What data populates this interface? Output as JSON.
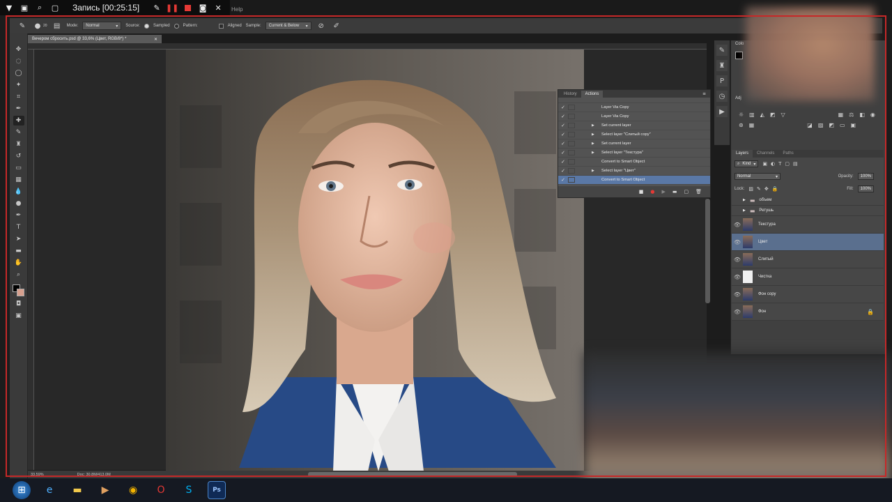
{
  "recorder": {
    "title": "Запись [00:25:15]",
    "icons": [
      "menu-icon",
      "window-icon",
      "zoom-icon",
      "crop-icon",
      "pen-icon",
      "pause-icon",
      "stop-icon",
      "camera-icon",
      "close-icon"
    ]
  },
  "menubar": {
    "help": "Help"
  },
  "options": {
    "mode_label": "Mode:",
    "mode_value": "Normal",
    "source_label": "Source:",
    "sampled_label": "Sampled",
    "pattern_label": "Pattern:",
    "aligned_label": "Aligned",
    "sample_label": "Sample:",
    "sample_value": "Current & Below",
    "brush_size": "20"
  },
  "document": {
    "tab_title": "Вечером сбросить.psd @ 33,6% (Цвет, RGB/8*) *",
    "zoom": "33,59%",
    "doc_info": "Doc: 30,8M/413,0M"
  },
  "actions_panel": {
    "tabs": [
      "History",
      "Actions"
    ],
    "active_tab": "Actions",
    "rows": [
      {
        "label": "Layer Via Copy",
        "arrow": false,
        "selected": false
      },
      {
        "label": "Layer Via Copy",
        "arrow": false,
        "selected": false
      },
      {
        "label": "Set current layer",
        "arrow": true,
        "selected": false
      },
      {
        "label": "Select layer \"Слитый copy\"",
        "arrow": true,
        "selected": false
      },
      {
        "label": "Set current layer",
        "arrow": true,
        "selected": false
      },
      {
        "label": "Select layer \"Текстура\"",
        "arrow": true,
        "selected": false
      },
      {
        "label": "Convert to Smart Object",
        "arrow": false,
        "selected": false
      },
      {
        "label": "Select layer \"Цвет\"",
        "arrow": true,
        "selected": false
      },
      {
        "label": "Convert to Smart Object",
        "arrow": false,
        "selected": true
      }
    ]
  },
  "layers_panel": {
    "tabs": [
      "Layers",
      "Channels",
      "Paths"
    ],
    "active_tab": "Layers",
    "kind_label": "Kind",
    "blend_mode": "Normal",
    "opacity_label": "Opacity:",
    "opacity_value": "100%",
    "lock_label": "Lock:",
    "fill_label": "Fill:",
    "fill_value": "100%",
    "rows": [
      {
        "name": "объем",
        "type": "group",
        "selected": false,
        "visible": false,
        "locked": false
      },
      {
        "name": "Ретушь",
        "type": "group",
        "selected": false,
        "visible": false,
        "locked": false
      },
      {
        "name": "Текстура",
        "type": "photo",
        "selected": false,
        "visible": true,
        "locked": false
      },
      {
        "name": "Цвет",
        "type": "photo",
        "selected": true,
        "visible": true,
        "locked": false
      },
      {
        "name": "Слитый",
        "type": "photo",
        "selected": false,
        "visible": true,
        "locked": false
      },
      {
        "name": "Чистка",
        "type": "white",
        "selected": false,
        "visible": true,
        "locked": false
      },
      {
        "name": "Фон copy",
        "type": "photo",
        "selected": false,
        "visible": true,
        "locked": false
      },
      {
        "name": "Фон",
        "type": "photo",
        "selected": false,
        "visible": true,
        "locked": true
      }
    ]
  },
  "side_panel": {
    "color_label": "Colo",
    "adjustments_label": "Adj"
  },
  "taskbar": {
    "apps": [
      "windows-start",
      "internet-explorer",
      "file-explorer",
      "media-player",
      "chrome",
      "opera",
      "skype",
      "photoshop"
    ],
    "ps_label": "Ps"
  },
  "colors": {
    "selection": "#5a6f8e",
    "record_frame": "#c62828",
    "bg_swatch": "#d7a08e"
  }
}
